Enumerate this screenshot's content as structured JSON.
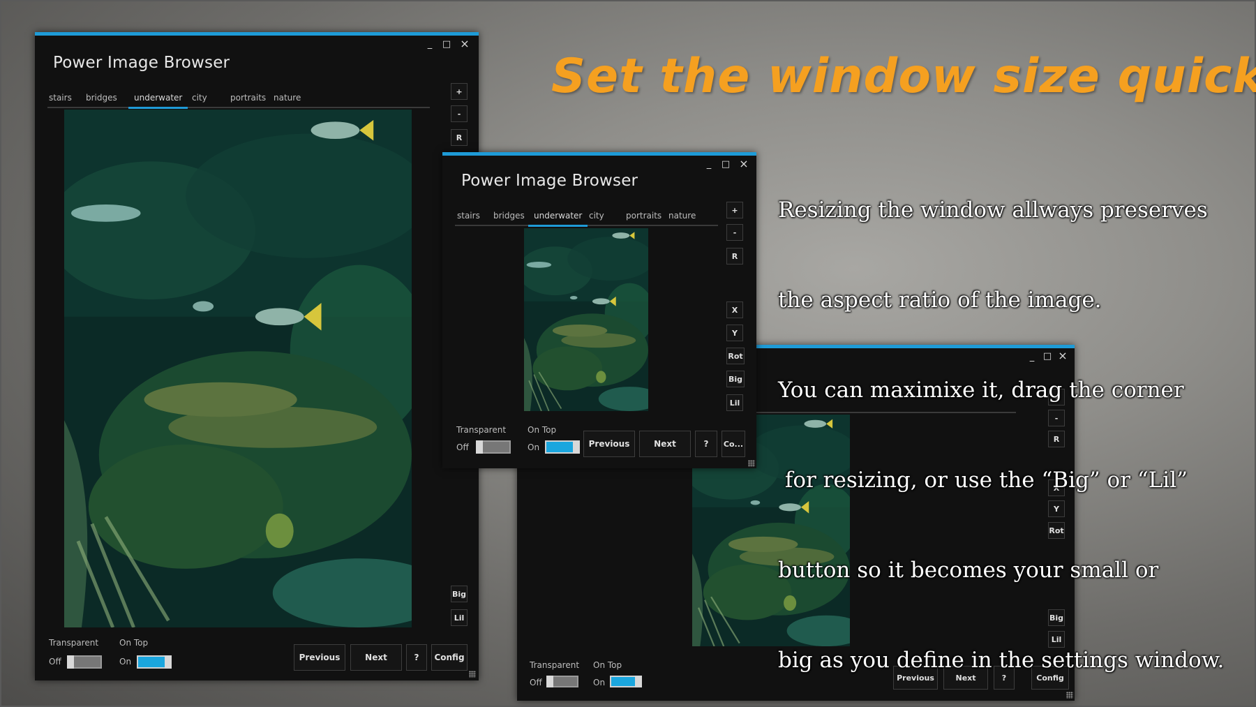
{
  "app_title": "Power Image Browser",
  "window_controls": {
    "minimize": "_",
    "maximize": "□",
    "close": "×"
  },
  "tabs": [
    "stairs",
    "bridges",
    "underwater",
    "city",
    "portraits",
    "nature"
  ],
  "active_tab": "underwater",
  "side_buttons": {
    "plus": "+",
    "minus": "-",
    "reset": "R",
    "x": "X",
    "y": "Y",
    "rotate": "Rot",
    "big": "Big",
    "lil": "Lil"
  },
  "bottom_buttons": {
    "previous": "Previous",
    "next": "Next",
    "help": "?",
    "config": "Config",
    "config_truncated": "Co..."
  },
  "toggles": {
    "transparent": {
      "label": "Transparent",
      "state_label": "Off",
      "on": false
    },
    "on_top": {
      "label": "On Top",
      "state_label": "On",
      "on": true
    }
  },
  "headline": "Set the window size quickly",
  "description_lines": [
    "Resizing the window allways preserves",
    "the aspect ratio of the image.",
    "You can maximixe it, drag the corner",
    " for resizing, or use the “Big” or “Lil”",
    "button so it becomes your small or",
    "big as you define in the settings window."
  ],
  "colors": {
    "accent": "#1e9bd7",
    "headline": "#f5a020",
    "toggle_on": "#1aa6de",
    "window_bg": "#111111"
  },
  "icons": [
    "minimize-icon",
    "maximize-icon",
    "close-icon",
    "resize-grip-icon"
  ]
}
